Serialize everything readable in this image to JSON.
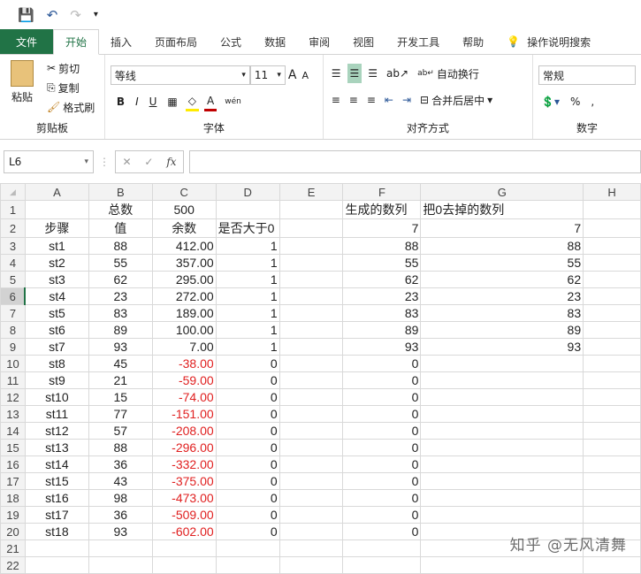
{
  "qat": {
    "save": "💾",
    "undo": "↶",
    "redo": "↷",
    "more": "▾"
  },
  "tabs": [
    "文件",
    "开始",
    "插入",
    "页面布局",
    "公式",
    "数据",
    "审阅",
    "视图",
    "开发工具",
    "帮助"
  ],
  "search_label": "操作说明搜索",
  "clipboard": {
    "paste": "粘贴",
    "cut": "剪切",
    "copy": "复制",
    "format_painter": "格式刷",
    "label": "剪贴板"
  },
  "font": {
    "name": "等线",
    "size": "11",
    "label": "字体",
    "bold": "B",
    "italic": "I",
    "underline": "U",
    "grow": "A",
    "shrink": "A",
    "phonetic": "wén"
  },
  "alignment": {
    "wrap": "自动换行",
    "merge": "合并后居中",
    "label": "对齐方式"
  },
  "number": {
    "format": "常规",
    "percent": "%",
    "comma": ",",
    "label": "数字"
  },
  "formula_bar": {
    "name_box": "L6",
    "fx": "fx",
    "value": ""
  },
  "columns": [
    "A",
    "B",
    "C",
    "D",
    "E",
    "F",
    "G",
    "H"
  ],
  "selected_row": 6,
  "rows": [
    [
      "",
      "总数",
      "500",
      "",
      "",
      "生成的数列",
      "把0去掉的数列",
      ""
    ],
    [
      "步骤",
      "值",
      "余数",
      "是否大于0",
      "",
      "7",
      "7",
      ""
    ],
    [
      "st1",
      "88",
      "412.00",
      "1",
      "",
      "88",
      "88",
      ""
    ],
    [
      "st2",
      "55",
      "357.00",
      "1",
      "",
      "55",
      "55",
      ""
    ],
    [
      "st3",
      "62",
      "295.00",
      "1",
      "",
      "62",
      "62",
      ""
    ],
    [
      "st4",
      "23",
      "272.00",
      "1",
      "",
      "23",
      "23",
      ""
    ],
    [
      "st5",
      "83",
      "189.00",
      "1",
      "",
      "83",
      "83",
      ""
    ],
    [
      "st6",
      "89",
      "100.00",
      "1",
      "",
      "89",
      "89",
      ""
    ],
    [
      "st7",
      "93",
      "7.00",
      "1",
      "",
      "93",
      "93",
      ""
    ],
    [
      "st8",
      "45",
      "-38.00",
      "0",
      "",
      "0",
      "",
      ""
    ],
    [
      "st9",
      "21",
      "-59.00",
      "0",
      "",
      "0",
      "",
      ""
    ],
    [
      "st10",
      "15",
      "-74.00",
      "0",
      "",
      "0",
      "",
      ""
    ],
    [
      "st11",
      "77",
      "-151.00",
      "0",
      "",
      "0",
      "",
      ""
    ],
    [
      "st12",
      "57",
      "-208.00",
      "0",
      "",
      "0",
      "",
      ""
    ],
    [
      "st13",
      "88",
      "-296.00",
      "0",
      "",
      "0",
      "",
      ""
    ],
    [
      "st14",
      "36",
      "-332.00",
      "0",
      "",
      "0",
      "",
      ""
    ],
    [
      "st15",
      "43",
      "-375.00",
      "0",
      "",
      "0",
      "",
      ""
    ],
    [
      "st16",
      "98",
      "-473.00",
      "0",
      "",
      "0",
      "",
      ""
    ],
    [
      "st17",
      "36",
      "-509.00",
      "0",
      "",
      "0",
      "",
      ""
    ],
    [
      "st18",
      "93",
      "-602.00",
      "0",
      "",
      "0",
      "",
      ""
    ],
    [
      "",
      "",
      "",
      "",
      "",
      "",
      "",
      ""
    ],
    [
      "",
      "",
      "",
      "",
      "",
      "",
      "",
      ""
    ]
  ],
  "colors": {
    "accent": "#217346",
    "negative": "#e02020"
  },
  "watermark": "知乎 @无风清舞"
}
